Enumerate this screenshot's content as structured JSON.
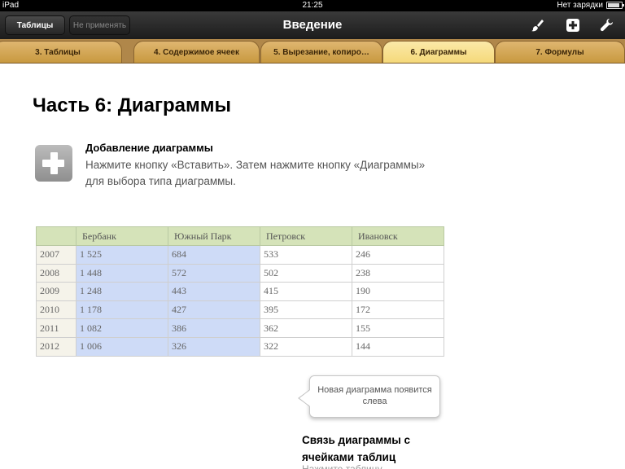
{
  "status_bar": {
    "device": "iPad",
    "time": "21:25",
    "battery_text": "Нет зарядки"
  },
  "toolbar": {
    "sheets_button": "Таблицы",
    "undo_button": "Не применять",
    "title": "Введение",
    "icons": [
      "paintbrush-icon",
      "add-icon",
      "wrench-icon"
    ]
  },
  "tabs": [
    {
      "label": "3. Таблицы",
      "active": false
    },
    {
      "label": "4. Содержимое ячеек",
      "active": false
    },
    {
      "label": "5. Вырезание, копиро…",
      "active": false
    },
    {
      "label": "6. Диаграммы",
      "active": true
    },
    {
      "label": "7. Формулы",
      "active": false
    }
  ],
  "content": {
    "heading": "Часть 6: Диаграммы",
    "add_chart": {
      "title": "Добавление диаграммы",
      "text": "Нажмите кнопку «Вставить». Затем нажмите кнопку «Диаграммы» для выбора типа диаграммы."
    },
    "table": {
      "headers": [
        "",
        "Бербанк",
        "Южный Парк",
        "Петровск",
        "Ивановск"
      ],
      "rows": [
        [
          "2007",
          "1 525",
          "684",
          "533",
          "246"
        ],
        [
          "2008",
          "1 448",
          "572",
          "502",
          "238"
        ],
        [
          "2009",
          "1 248",
          "443",
          "415",
          "190"
        ],
        [
          "2010",
          "1 178",
          "427",
          "395",
          "172"
        ],
        [
          "2011",
          "1 082",
          "386",
          "362",
          "155"
        ],
        [
          "2012",
          "1 006",
          "326",
          "322",
          "144"
        ]
      ]
    },
    "callout": "Новая диаграмма появится слева",
    "link_section": {
      "title": "Связь диаграммы с ячейками таблиц",
      "text": "Нажмите таблицу…"
    }
  }
}
